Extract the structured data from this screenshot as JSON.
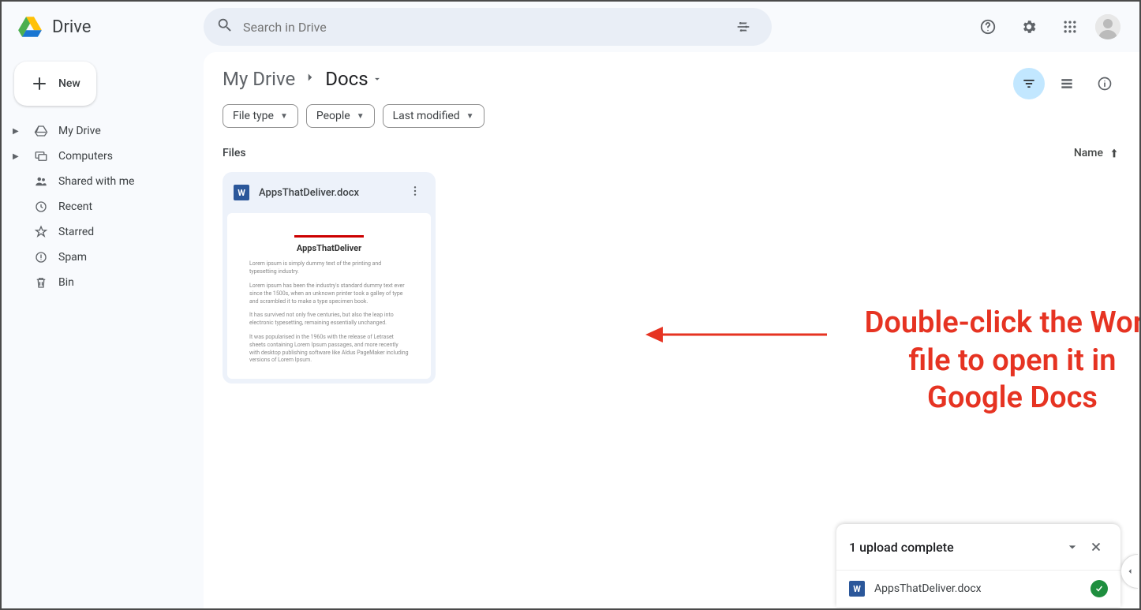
{
  "app": {
    "name": "Drive"
  },
  "search": {
    "placeholder": "Search in Drive"
  },
  "sidebar": {
    "new_label": "New",
    "items": [
      {
        "label": "My Drive",
        "icon": "my-drive",
        "expandable": true
      },
      {
        "label": "Computers",
        "icon": "computers",
        "expandable": true
      },
      {
        "label": "Shared with me",
        "icon": "shared",
        "expandable": false
      },
      {
        "label": "Recent",
        "icon": "recent",
        "expandable": false
      },
      {
        "label": "Starred",
        "icon": "starred",
        "expandable": false
      },
      {
        "label": "Spam",
        "icon": "spam",
        "expandable": false
      },
      {
        "label": "Bin",
        "icon": "bin",
        "expandable": false
      }
    ]
  },
  "breadcrumb": {
    "root": "My Drive",
    "current": "Docs"
  },
  "filters": {
    "file_type": "File type",
    "people": "People",
    "last_modified": "Last modified"
  },
  "files_section": {
    "label": "Files",
    "sort_by": "Name"
  },
  "files": [
    {
      "name": "AppsThatDeliver.docx",
      "thumb_title": "AppsThatDeliver"
    }
  ],
  "annotation": {
    "line1": "Double-click the Word",
    "line2": "file to open it in",
    "line3": "Google Docs"
  },
  "upload_toast": {
    "title": "1 upload complete",
    "items": [
      {
        "name": "AppsThatDeliver.docx"
      }
    ]
  },
  "colors": {
    "annotation": "#e63322",
    "word_blue": "#2b579a",
    "success_green": "#1e8e3e",
    "filter_active_bg": "#c2e7ff"
  }
}
